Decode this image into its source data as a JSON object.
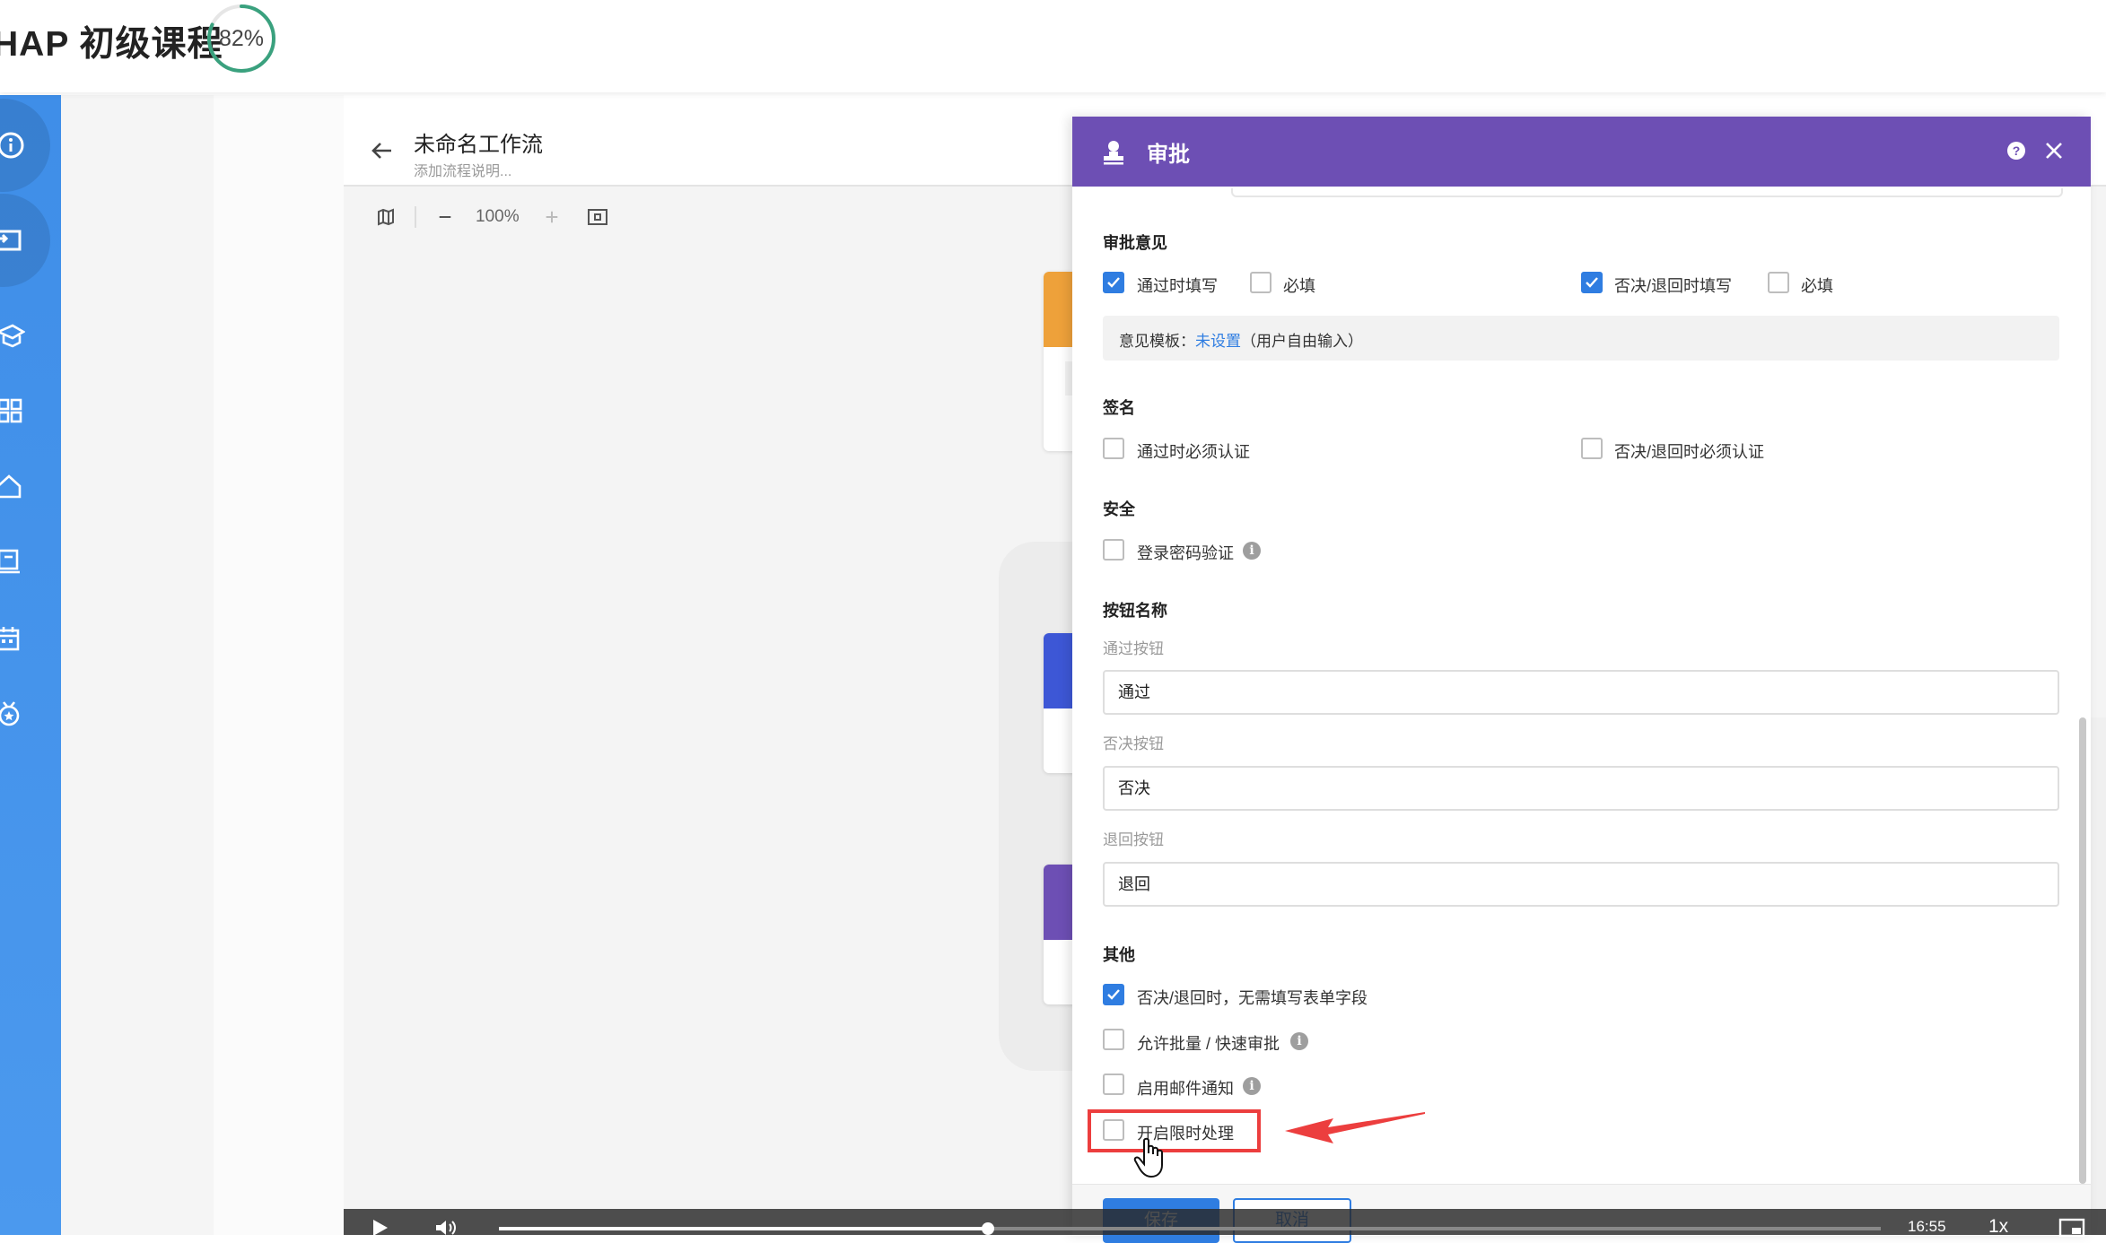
{
  "header": {
    "course_title": "HAP 初级课程",
    "progress_label": "82%",
    "progress_value": 0.82
  },
  "editor": {
    "title": "未命名工作流",
    "description": "添加流程说明...",
    "zoom": "100%"
  },
  "panel": {
    "title": "审批",
    "accent_color": "#6d4fb4",
    "opinion": {
      "title": "审批意见",
      "pass_fill_label": "通过时填写",
      "pass_fill_checked": true,
      "pass_required_label": "必填",
      "pass_required_checked": false,
      "reject_fill_label": "否决/退回时填写",
      "reject_fill_checked": true,
      "reject_required_label": "必填",
      "reject_required_checked": false,
      "template_prefix": "意见模板：",
      "template_link": "未设置",
      "template_suffix": "（用户自由输入）"
    },
    "signature": {
      "title": "签名",
      "pass_auth_label": "通过时必须认证",
      "reject_auth_label": "否决/退回时必须认证"
    },
    "security": {
      "title": "安全",
      "password_label": "登录密码验证"
    },
    "buttons": {
      "title": "按钮名称",
      "pass_label": "通过按钮",
      "pass_value": "通过",
      "reject_label": "否决按钮",
      "reject_value": "否决",
      "return_label": "退回按钮",
      "return_value": "退回"
    },
    "other": {
      "title": "其他",
      "no_fill_label": "否决/退回时，无需填写表单字段",
      "no_fill_checked": true,
      "batch_label": "允许批量 / 快速审批",
      "email_label": "启用邮件通知",
      "time_limit_label": "开启限时处理"
    },
    "footer": {
      "save": "保存",
      "cancel": "取消"
    }
  },
  "video": {
    "time": "16:55",
    "speed": "1x"
  }
}
